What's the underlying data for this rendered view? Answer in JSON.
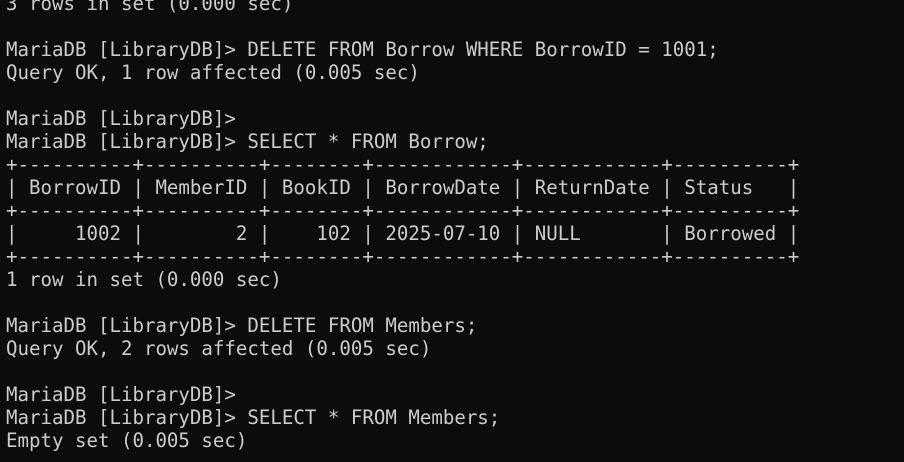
{
  "terminal": {
    "lines": [
      "3 rows in set (0.000 sec)",
      "",
      "MariaDB [LibraryDB]> DELETE FROM Borrow WHERE BorrowID = 1001;",
      "Query OK, 1 row affected (0.005 sec)",
      "",
      "MariaDB [LibraryDB]>",
      "MariaDB [LibraryDB]> SELECT * FROM Borrow;",
      "+----------+----------+--------+------------+------------+----------+",
      "| BorrowID | MemberID | BookID | BorrowDate | ReturnDate | Status   |",
      "+----------+----------+--------+------------+------------+----------+",
      "|     1002 |        2 |    102 | 2025-07-10 | NULL       | Borrowed |",
      "+----------+----------+--------+------------+------------+----------+",
      "1 row in set (0.000 sec)",
      "",
      "MariaDB [LibraryDB]> DELETE FROM Members;",
      "Query OK, 2 rows affected (0.005 sec)",
      "",
      "MariaDB [LibraryDB]>",
      "MariaDB [LibraryDB]> SELECT * FROM Members;",
      "Empty set (0.005 sec)"
    ]
  },
  "colors": {
    "background": "#0c0c0c",
    "text": "#cccccc"
  }
}
